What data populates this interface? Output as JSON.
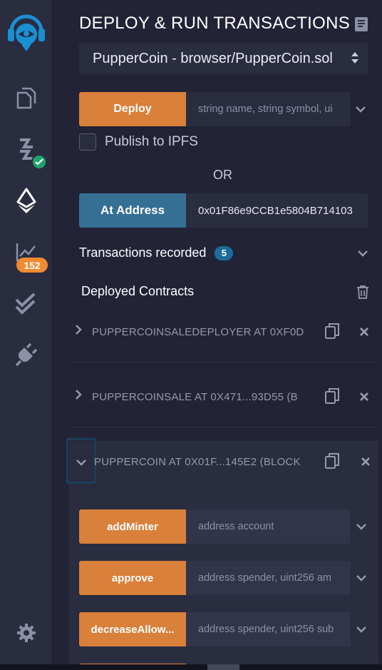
{
  "rail": {
    "icons": [
      "remix-logo-icon",
      "file-explorer-icon",
      "compiler-icon",
      "deploy-icon",
      "analysis-icon",
      "testing-icon",
      "plugin-icon",
      "settings-icon"
    ],
    "analysis_badge": "152",
    "colors": {
      "rail_bg": "#2a2c3f",
      "logo": "#1a8fd1",
      "badge_orange": "#f18b30",
      "check_green": "#1fa36b"
    }
  },
  "panel": {
    "title": "DEPLOY & RUN TRANSACTIONS",
    "contract_select": "PupperCoin - browser/PupperCoin.sol",
    "deploy": {
      "label": "Deploy",
      "placeholder": "string name, string symbol, ui"
    },
    "publish_ipfs_label": "Publish to IPFS",
    "or_label": "OR",
    "at_address": {
      "label": "At Address",
      "value": "0x01F86e9CCB1e5804B714103"
    },
    "transactions_recorded": {
      "label": "Transactions recorded",
      "count": "5"
    },
    "deployed_contracts_label": "Deployed Contracts",
    "instances": [
      {
        "title": "PUPPERCOINSALEDEPLOYER AT 0XF0D"
      },
      {
        "title": "PUPPERCOINSALE AT 0X471...93D55 (B"
      }
    ],
    "expanded_instance": {
      "title": "PUPPERCOIN AT 0X01F...145E2 (BLOCK",
      "functions": [
        {
          "label": "addMinter",
          "placeholder": "address account"
        },
        {
          "label": "approve",
          "placeholder": "address spender, uint256 am"
        },
        {
          "label": "decreaseAllow...",
          "placeholder": "address spender, uint256 sub"
        }
      ]
    },
    "colors": {
      "orange_button": "#d9803b",
      "blue_button": "#366f94",
      "badge_blue": "#1a6d9a"
    }
  }
}
